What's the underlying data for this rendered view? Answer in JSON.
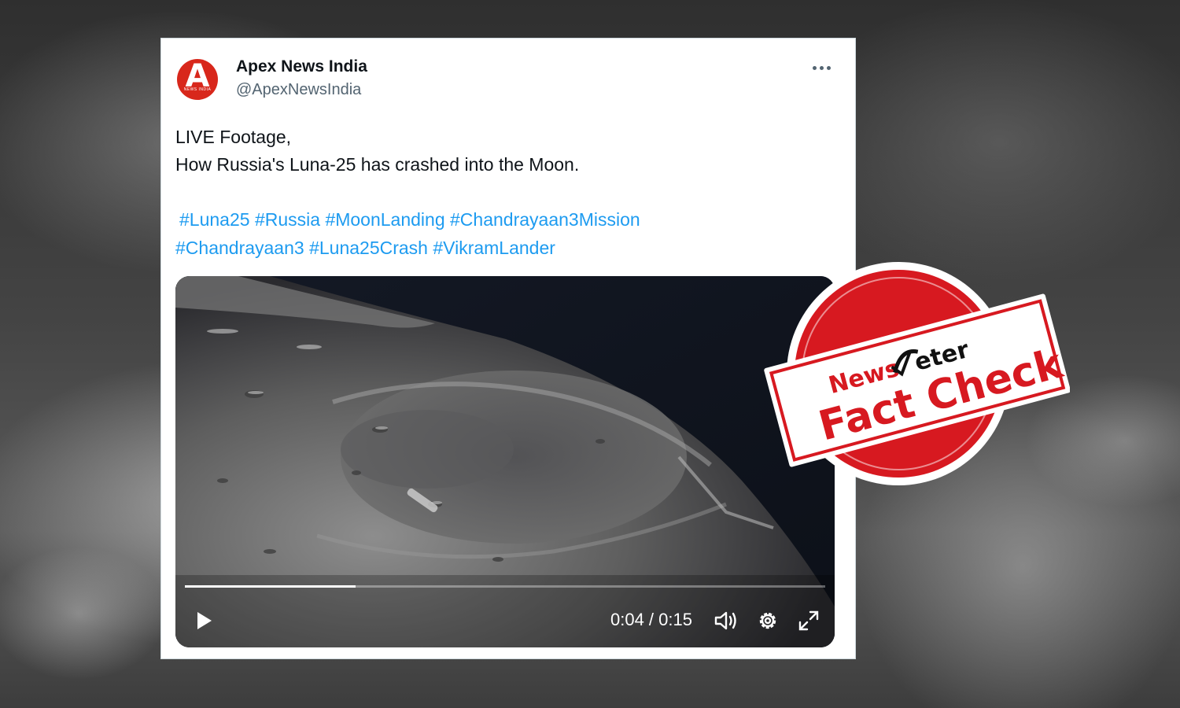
{
  "tweet": {
    "author_name": "Apex News India",
    "author_handle": "@ApexNewsIndia",
    "avatar_letter": "A",
    "avatar_subtext": "NEWS INDIA",
    "text_line1": "LIVE Footage,",
    "text_line2": "How Russia's Luna-25 has crashed into the Moon.",
    "hashtags_line1": [
      "#Luna25",
      "#Russia",
      "#MoonLanding",
      "#Chandrayaan3Mission"
    ],
    "hashtags_line2": [
      "#Chandrayaan3",
      "#Luna25Crash",
      "#VikramLander"
    ]
  },
  "video": {
    "time_display": "0:04 / 0:15",
    "progress_fraction": 0.2667
  },
  "stamp": {
    "brand": "NewsMeter",
    "label": "Fact Check",
    "color": "#d71920"
  },
  "icons": {
    "more": "more-horizontal-icon",
    "play": "play-icon",
    "volume": "volume-icon",
    "settings": "gear-icon",
    "fullscreen": "fullscreen-icon"
  }
}
